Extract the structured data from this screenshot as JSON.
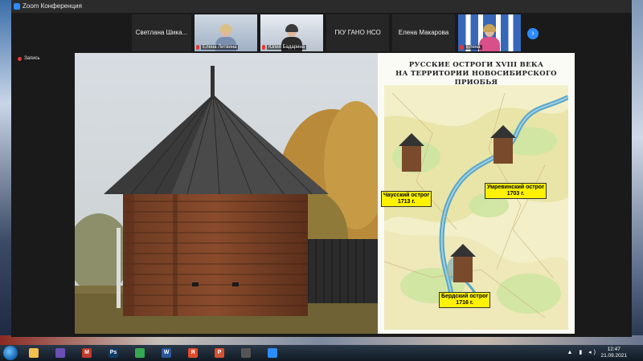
{
  "window": {
    "title": "Zoom Конференция"
  },
  "participants": [
    {
      "name": "Светлана  Шика...",
      "mode": "name"
    },
    {
      "name": "Елена Литвина",
      "mode": "video"
    },
    {
      "name": "Юлия Бадарина",
      "mode": "video"
    },
    {
      "name": "ГКУ ГАНО НСО",
      "mode": "name"
    },
    {
      "name": "Елена Макарова",
      "mode": "name"
    },
    {
      "name": "Елена",
      "mode": "video"
    }
  ],
  "share": {
    "label": "Запись"
  },
  "slide": {
    "map_title_line1": "РУССКИЕ ОСТРОГИ XVIII ВЕКА",
    "map_title_line2": "НА ТЕРРИТОРИИ НОВОСИБИРСКОГО ПРИОБЬЯ",
    "forts": [
      {
        "line1": "Чаусский острог",
        "line2": "1713 г."
      },
      {
        "line1": "Умревинский острог",
        "line2": "1703 г."
      },
      {
        "line1": "Бердский острог",
        "line2": "1716 г."
      }
    ]
  },
  "taskbar": {
    "apps": [
      {
        "name": "folder-icon",
        "color": "#f2c14e",
        "glyph": ""
      },
      {
        "name": "media-icon",
        "color": "#6a4fb5",
        "glyph": ""
      },
      {
        "name": "mail-icon",
        "color": "#c0392b",
        "glyph": "M"
      },
      {
        "name": "photoshop-icon",
        "color": "#0f3a66",
        "glyph": "Ps"
      },
      {
        "name": "chrome-icon",
        "color": "#34a853",
        "glyph": ""
      },
      {
        "name": "word-icon",
        "color": "#2b5797",
        "glyph": "W"
      },
      {
        "name": "yandex-icon",
        "color": "#e04b2b",
        "glyph": "Я"
      },
      {
        "name": "powerpoint-icon",
        "color": "#d35230",
        "glyph": "P"
      },
      {
        "name": "microphone-icon",
        "color": "#555555",
        "glyph": ""
      },
      {
        "name": "zoom-icon",
        "color": "#2d8cff",
        "glyph": ""
      }
    ],
    "time": "12:47",
    "date": "21.09.2021"
  }
}
